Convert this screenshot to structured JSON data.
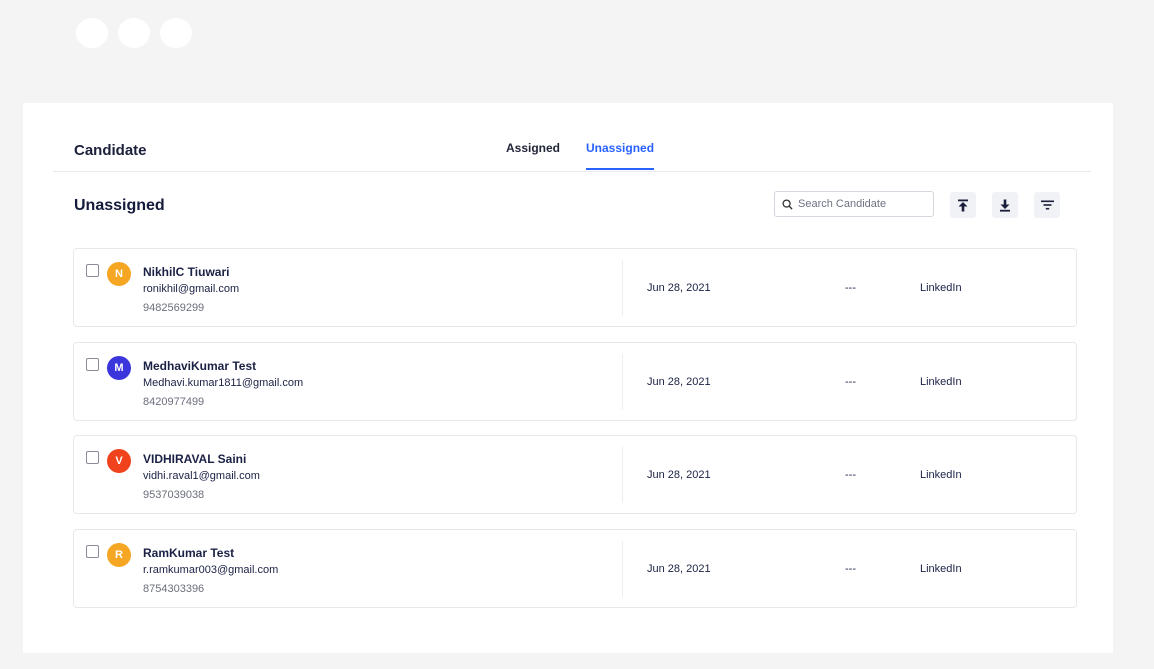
{
  "header": {
    "title": "Candidate",
    "tabs": [
      {
        "label": "Assigned",
        "active": false
      },
      {
        "label": "Unassigned",
        "active": true
      }
    ]
  },
  "section": {
    "title": "Unassigned"
  },
  "search": {
    "placeholder": "Search Candidate",
    "value": ""
  },
  "toolbar": {
    "icons": [
      "upload-icon",
      "download-icon",
      "filter-icon"
    ]
  },
  "colors": {
    "accent": "#2962ff",
    "avatar_orange": "#f5a623",
    "avatar_purple": "#3a36db",
    "avatar_red": "#f0421c"
  },
  "candidates": [
    {
      "initial": "N",
      "avatar_color": "#f5a623",
      "name": "NikhilC Tiuwari",
      "email": "ronikhil@gmail.com",
      "phone": "9482569299",
      "date": "Jun 28, 2021",
      "status": "---",
      "source": "LinkedIn",
      "checked": false
    },
    {
      "initial": "M",
      "avatar_color": "#3a36db",
      "name": "MedhaviKumar Test",
      "email": "Medhavi.kumar1811@gmail.com",
      "phone": "8420977499",
      "date": "Jun 28, 2021",
      "status": "---",
      "source": "LinkedIn",
      "checked": false
    },
    {
      "initial": "V",
      "avatar_color": "#f0421c",
      "name": "VIDHIRAVAL Saini",
      "email": "vidhi.raval1@gmail.com",
      "phone": "9537039038",
      "date": "Jun 28, 2021",
      "status": "---",
      "source": "LinkedIn",
      "checked": false
    },
    {
      "initial": "R",
      "avatar_color": "#f5a623",
      "name": "RamKumar Test",
      "email": "r.ramkumar003@gmail.com",
      "phone": "8754303396",
      "date": "Jun 28, 2021",
      "status": "---",
      "source": "LinkedIn",
      "checked": false
    }
  ]
}
